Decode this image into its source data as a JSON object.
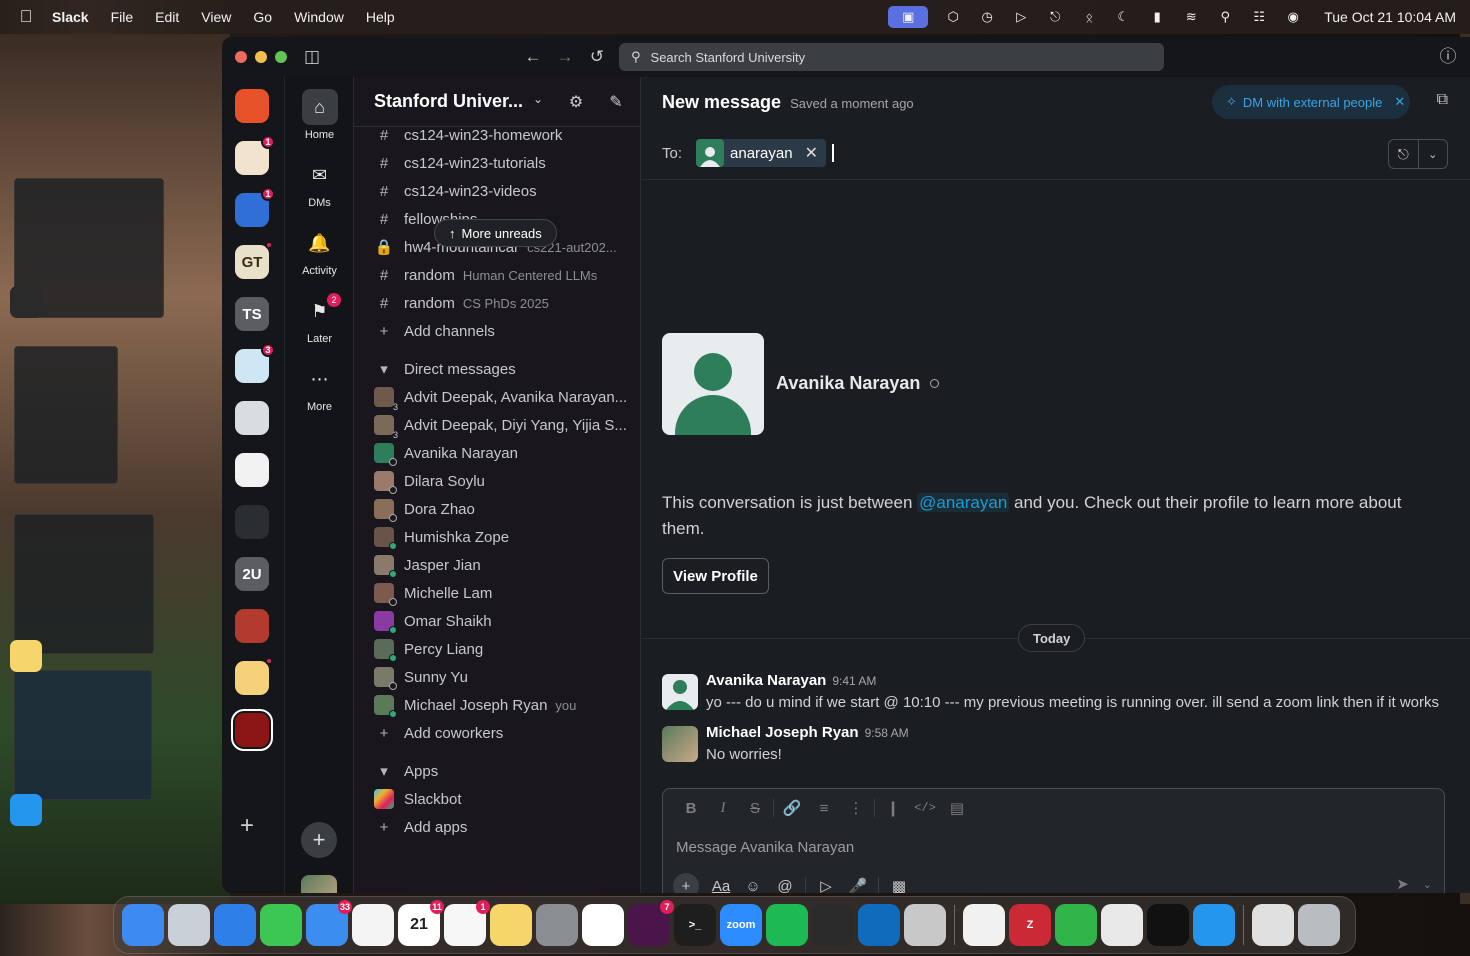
{
  "menubar": {
    "app": "Slack",
    "menus": [
      "File",
      "Edit",
      "View",
      "Go",
      "Window",
      "Help"
    ],
    "clock": "Tue Oct 21  10:04 AM",
    "status_icons": [
      "stage-manager-icon",
      "cube-icon",
      "time-machine-icon",
      "play-icon",
      "headphones-icon",
      "bluetooth-icon",
      "moon-icon",
      "battery-icon",
      "wifi-icon",
      "search-icon",
      "control-center-icon",
      "siri-icon"
    ]
  },
  "titlebar": {
    "search_placeholder": "Search Stanford University"
  },
  "workspaces": [
    {
      "name": "ws-1",
      "color": "#e8522a",
      "label": "",
      "badge": ""
    },
    {
      "name": "ws-2",
      "color": "#f2e3cf",
      "label": "",
      "badge": "1"
    },
    {
      "name": "ws-3",
      "color": "#2f6fd6",
      "label": "",
      "badge": "1"
    },
    {
      "name": "ws-georgia-tech",
      "color": "#e8e0c8",
      "label": "GT",
      "badge": "dot"
    },
    {
      "name": "ws-ts",
      "color": "#5a5d62",
      "label": "TS",
      "badge": ""
    },
    {
      "name": "ws-6",
      "color": "#cfe6f5",
      "label": "",
      "badge": "3"
    },
    {
      "name": "ws-7",
      "color": "#d8dde2",
      "label": "",
      "badge": ""
    },
    {
      "name": "ws-8",
      "color": "#f2f2f2",
      "label": "",
      "badge": ""
    },
    {
      "name": "ws-9",
      "color": "#2a2d31",
      "label": "",
      "badge": ""
    },
    {
      "name": "ws-2u",
      "color": "#5a5d62",
      "label": "2U",
      "badge": ""
    },
    {
      "name": "ws-11",
      "color": "#b33a2e",
      "label": "",
      "badge": ""
    },
    {
      "name": "ws-12",
      "color": "#f5d27a",
      "label": "",
      "badge": "dot"
    },
    {
      "name": "ws-stanford",
      "color": "#8c1515",
      "label": "",
      "badge": ""
    }
  ],
  "nav": {
    "home": "Home",
    "dms": "DMs",
    "activity": "Activity",
    "later": "Later",
    "later_badge": "2",
    "more": "More"
  },
  "sidebar": {
    "workspace_title": "Stanford Univer...",
    "more_unreads": "More unreads",
    "channels": [
      {
        "icon": "#",
        "name": "cs124-win23-homework",
        "sub": ""
      },
      {
        "icon": "#",
        "name": "cs124-win23-tutorials",
        "sub": ""
      },
      {
        "icon": "#",
        "name": "cs124-win23-videos",
        "sub": ""
      },
      {
        "icon": "#",
        "name": "fellowships",
        "sub": ""
      },
      {
        "icon": "lock",
        "name": "hw4-mountaincar",
        "sub": "cs221-aut202..."
      },
      {
        "icon": "#",
        "name": "random",
        "sub": "Human Centered LLMs"
      },
      {
        "icon": "#",
        "name": "random",
        "sub": "CS PhDs 2025"
      }
    ],
    "add_channels": "Add channels",
    "dm_section": "Direct messages",
    "dms": [
      {
        "name": "Advit Deepak, Avanika Narayan...",
        "sub": "",
        "group": "3"
      },
      {
        "name": "Advit Deepak, Diyi Yang, Yijia S...",
        "sub": "",
        "group": "3"
      },
      {
        "name": "Avanika Narayan",
        "sub": "",
        "group": ""
      },
      {
        "name": "Dilara Soylu",
        "sub": "",
        "group": ""
      },
      {
        "name": "Dora Zhao",
        "sub": "",
        "group": ""
      },
      {
        "name": "Humishka Zope",
        "sub": "",
        "group": ""
      },
      {
        "name": "Jasper Jian",
        "sub": "",
        "group": ""
      },
      {
        "name": "Michelle Lam",
        "sub": "",
        "group": ""
      },
      {
        "name": "Omar Shaikh",
        "sub": "",
        "group": ""
      },
      {
        "name": "Percy Liang",
        "sub": "",
        "group": ""
      },
      {
        "name": "Sunny Yu",
        "sub": "",
        "group": ""
      },
      {
        "name": "Michael Joseph Ryan",
        "sub": "you",
        "group": ""
      }
    ],
    "add_coworkers": "Add coworkers",
    "apps_section": "Apps",
    "apps": [
      {
        "name": "Slackbot"
      }
    ],
    "add_apps": "Add apps"
  },
  "main": {
    "title": "New message",
    "saved": "Saved a moment ago",
    "ext_pill": "DM with external people",
    "to_label": "To:",
    "recipient": "anarayan",
    "intro_name": "Avanika Narayan",
    "intro_pre": "This conversation is just between ",
    "intro_mention": "@anarayan",
    "intro_post": " and you. Check out their profile to learn more about them.",
    "view_profile": "View Profile",
    "today": "Today",
    "messages": [
      {
        "author": "Avanika Narayan",
        "time": "9:41 AM",
        "text": "yo --- do u mind if we start @ 10:10 ---  my previous meeting is running over. ill send a zoom link then if it works"
      },
      {
        "author": "Michael Joseph Ryan",
        "time": "9:58 AM",
        "text": "No worries!"
      }
    ],
    "composer_placeholder": "Message Avanika Narayan"
  },
  "dock": {
    "apps": [
      {
        "name": "finder",
        "color": "#3d8bf2",
        "label": "",
        "badge": ""
      },
      {
        "name": "launchpad",
        "color": "#c9d0d8",
        "label": "",
        "badge": ""
      },
      {
        "name": "safari",
        "color": "#2f7fe8",
        "label": "",
        "badge": ""
      },
      {
        "name": "messages",
        "color": "#3cc653",
        "label": "",
        "badge": ""
      },
      {
        "name": "mail",
        "color": "#3b8ef0",
        "label": "",
        "badge": "33"
      },
      {
        "name": "photos",
        "color": "#f4f4f4",
        "label": "",
        "badge": ""
      },
      {
        "name": "calendar",
        "color": "#ffffff",
        "label": "21",
        "badge": "11"
      },
      {
        "name": "reminders",
        "color": "#f7f7f7",
        "label": "",
        "badge": "1"
      },
      {
        "name": "notes",
        "color": "#f6d66a",
        "label": "",
        "badge": ""
      },
      {
        "name": "system-settings",
        "color": "#8a8d92",
        "label": "",
        "badge": ""
      },
      {
        "name": "chatgpt",
        "color": "#ffffff",
        "label": "",
        "badge": ""
      },
      {
        "name": "slack",
        "color": "#4a154b",
        "label": "",
        "badge": "7"
      },
      {
        "name": "terminal",
        "color": "#1e1e1e",
        "label": ">_",
        "badge": ""
      },
      {
        "name": "zoom",
        "color": "#2d8cff",
        "label": "zoom",
        "badge": ""
      },
      {
        "name": "spotify",
        "color": "#1db954",
        "label": "",
        "badge": ""
      },
      {
        "name": "cube-app",
        "color": "#2a2a2a",
        "label": "",
        "badge": ""
      },
      {
        "name": "outlook",
        "color": "#0f6cbd",
        "label": "",
        "badge": ""
      },
      {
        "name": "iphone-mirroring",
        "color": "#c8c8c8",
        "label": "",
        "badge": ""
      },
      {
        "name": "chrome",
        "color": "#f1f1f1",
        "label": "",
        "badge": ""
      },
      {
        "name": "zotero",
        "color": "#cc2936",
        "label": "Z",
        "badge": ""
      },
      {
        "name": "numbers",
        "color": "#2fb54a",
        "label": "",
        "badge": ""
      },
      {
        "name": "keychain",
        "color": "#e9e9e9",
        "label": "",
        "badge": ""
      },
      {
        "name": "exec-terminal",
        "color": "#111111",
        "label": "",
        "badge": ""
      },
      {
        "name": "docker",
        "color": "#2496ed",
        "label": "",
        "badge": ""
      },
      {
        "name": "documents-stack",
        "color": "#e0e0e0",
        "label": "",
        "badge": ""
      },
      {
        "name": "trash",
        "color": "#b9bcc0",
        "label": "",
        "badge": ""
      }
    ]
  }
}
